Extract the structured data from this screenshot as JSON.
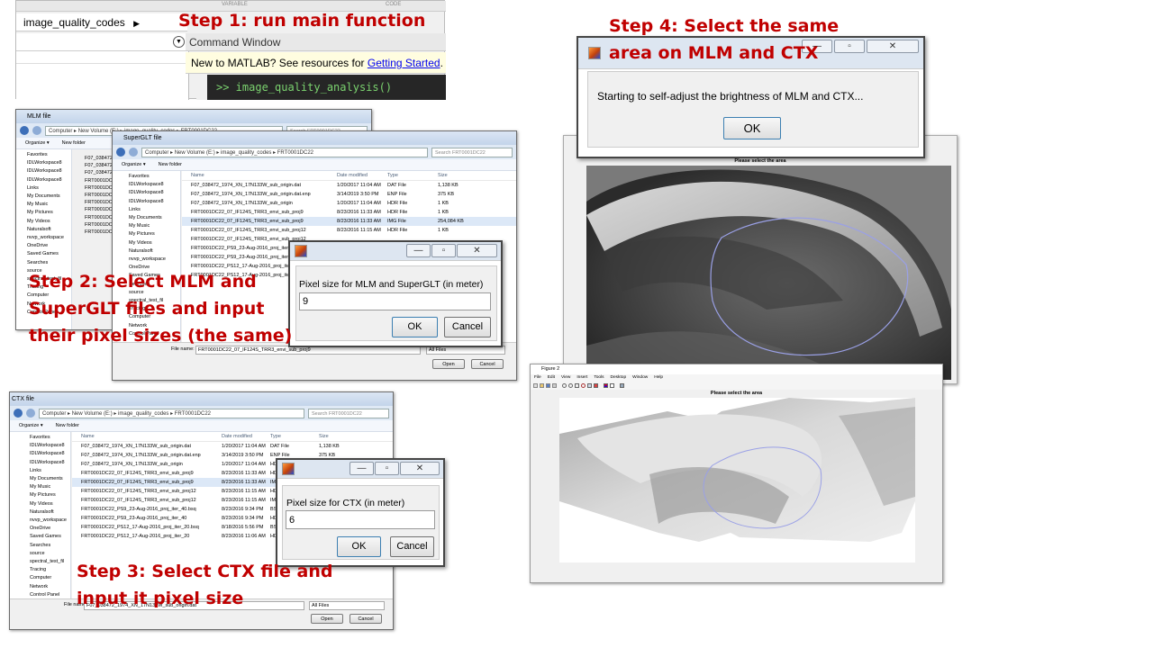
{
  "steps": {
    "s1": "Step 1: run main function",
    "s2": [
      "Step 2: Select MLM and",
      "SuperGLT files and input",
      "their pixel sizes (the same)"
    ],
    "s3": [
      "Step 3: Select CTX file and",
      "input it pixel size"
    ],
    "s4": [
      "Step 4: Select the same",
      "area on MLM and CTX"
    ]
  },
  "matlab": {
    "folder": "image_quality_codes",
    "top_hdr_1": "VARIABLE",
    "top_hdr_2": "CODE",
    "cmd_title": "Command Window",
    "notice_prefix": "New to MATLAB? See resources for ",
    "notice_link": "Getting Started",
    "notice_suffix": ".",
    "prompt": ">> image_quality_analysis()"
  },
  "colors": {
    "accent": "#c00000",
    "link": "#0000ee"
  },
  "explorer_left": [
    "Favorites",
    "IDLWorkspace8",
    "IDLWorkspace8",
    "IDLWorkspace8",
    "Links",
    "My Documents",
    "My Music",
    "My Pictures",
    "My Videos",
    "Naturalsoft",
    "nvvp_workspace",
    "OneDrive",
    "Saved Games",
    "Searches",
    "source",
    "spectral_test_fil",
    "Tracing",
    "Computer",
    "Network",
    "Control Panel"
  ],
  "win_mlm": {
    "title": "MLM file",
    "path": "Computer ▸ New Volume (E:) ▸ image_quality_codes ▸ FRT0001DC22",
    "search": "Search FRT0001DC22",
    "organize": "Organize ▾",
    "newfolder": "New folder",
    "files": [
      "F07_038472",
      "F07_038472",
      "F07_038472",
      "FRT0001DC",
      "FRT0001DC",
      "FRT0001DC",
      "FRT0001DC",
      "FRT0001DC",
      "FRT0001DC",
      "FRT0001DC",
      "FRT0001DC"
    ]
  },
  "win_sglt": {
    "title": "SuperGLT file",
    "path": "Computer ▸ New Volume (E:) ▸ image_quality_codes ▸ FRT0001DC22",
    "search": "Search FRT0001DC22",
    "organize": "Organize ▾",
    "newfolder": "New folder",
    "headers": [
      "Name",
      "Date modified",
      "Type",
      "Size"
    ],
    "rows": [
      [
        "F07_038472_1974_XN_17N133W_sub_origin.dat",
        "1/20/2017 11:04 AM",
        "DAT File",
        "1,138 KB"
      ],
      [
        "F07_038472_1974_XN_17N133W_sub_origin.dat.enp",
        "3/14/2019 3:50 PM",
        "ENP File",
        "375 KB"
      ],
      [
        "F07_038472_1974_XN_17N133W_sub_origin",
        "1/20/2017 11:04 AM",
        "HDR File",
        "1 KB"
      ],
      [
        "FRT0001DC22_07_IF124S_TRR3_envi_sub_proj9",
        "8/23/2016 11:33 AM",
        "HDR File",
        "1 KB"
      ],
      [
        "FRT0001DC22_07_IF124S_TRR3_envi_sub_proj9",
        "8/23/2016 11:33 AM",
        "IMG File",
        "254,084 KB"
      ],
      [
        "FRT0001DC22_07_IF124S_TRR3_envi_sub_proj12",
        "8/23/2016 11:15 AM",
        "HDR File",
        "1 KB"
      ],
      [
        "FRT0001DC22_07_IF124S_TRR3_envi_sub_proj12",
        "",
        "",
        ""
      ],
      [
        "FRT0001DC22_PS9_23-Aug-2016_proj_iter_40.",
        "",
        "",
        ""
      ],
      [
        "FRT0001DC22_PS9_23-Aug-2016_proj_iter_40",
        "",
        "",
        ""
      ],
      [
        "FRT0001DC22_PS12_17-Aug-2016_proj_iter_2",
        "",
        "",
        ""
      ],
      [
        "FRT0001DC22_PS12_17-Aug-2016_proj_iter_2",
        "",
        "",
        ""
      ]
    ],
    "filename_label": "File name:",
    "filename": "FRT0001DC22_07_IF124S_TRR3_envi_sub_proj9",
    "filter": "All Files",
    "open": "Open",
    "cancel": "Cancel"
  },
  "dlg_mlm": {
    "label": "Pixel size for MLM and SuperGLT (in meter)",
    "value": "9",
    "ok": "OK",
    "cancel": "Cancel"
  },
  "win_ctx": {
    "title": "CTX file",
    "path": "Computer ▸ New Volume (E:) ▸ image_quality_codes ▸ FRT0001DC22",
    "search": "Search FRT0001DC22",
    "organize": "Organize ▾",
    "newfolder": "New folder",
    "headers": [
      "Name",
      "Date modified",
      "Type",
      "Size"
    ],
    "rows": [
      [
        "F07_038472_1974_XN_17N133W_sub_origin.dat",
        "1/20/2017 11:04 AM",
        "DAT File",
        "1,138 KB"
      ],
      [
        "F07_038472_1974_XN_17N133W_sub_origin.dat.enp",
        "3/14/2019 3:50 PM",
        "ENP File",
        "375 KB"
      ],
      [
        "F07_038472_1974_XN_17N133W_sub_origin",
        "1/20/2017 11:04 AM",
        "HDR File",
        ""
      ],
      [
        "FRT0001DC22_07_IF124S_TRR3_envi_sub_proj9",
        "8/23/2016 11:33 AM",
        "HDR File",
        ""
      ],
      [
        "FRT0001DC22_07_IF124S_TRR3_envi_sub_proj9",
        "8/23/2016 11:33 AM",
        "IMG File",
        ""
      ],
      [
        "FRT0001DC22_07_IF124S_TRR3_envi_sub_proj12",
        "8/23/2016 11:15 AM",
        "HDR File",
        ""
      ],
      [
        "FRT0001DC22_07_IF124S_TRR3_envi_sub_proj12",
        "8/23/2016 11:15 AM",
        "IMG File",
        ""
      ],
      [
        "FRT0001DC22_PS9_23-Aug-2016_proj_iter_40.bsq",
        "8/23/2016 9:34 PM",
        "BSQ File",
        ""
      ],
      [
        "FRT0001DC22_PS9_23-Aug-2016_proj_iter_40",
        "8/23/2016 9:34 PM",
        "HDR File",
        ""
      ],
      [
        "FRT0001DC22_PS12_17-Aug-2016_proj_iter_20.bsq",
        "8/18/2016 5:56 PM",
        "BSQ File",
        ""
      ],
      [
        "FRT0001DC22_PS12_17-Aug-2016_proj_iter_20",
        "8/23/2016 11:06 AM",
        "HDR File",
        ""
      ]
    ],
    "filename_label": "File name:",
    "filename": "F07_038472_1974_XN_17N133W_sub_origin.dat",
    "filter": "All Files",
    "open": "Open",
    "cancel": "Cancel"
  },
  "dlg_ctx": {
    "label": "Pixel size for CTX (in meter)",
    "value": "6",
    "ok": "OK",
    "cancel": "Cancel"
  },
  "fig1": {
    "caption": "Please select the area"
  },
  "dlg_adjust": {
    "message": "Starting to self-adjust the brightness of MLM and CTX...",
    "ok": "OK"
  },
  "fig2": {
    "title": "Figure 2",
    "menu": [
      "File",
      "Edit",
      "View",
      "Insert",
      "Tools",
      "Desktop",
      "Window",
      "Help"
    ],
    "caption": "Please select the area"
  }
}
